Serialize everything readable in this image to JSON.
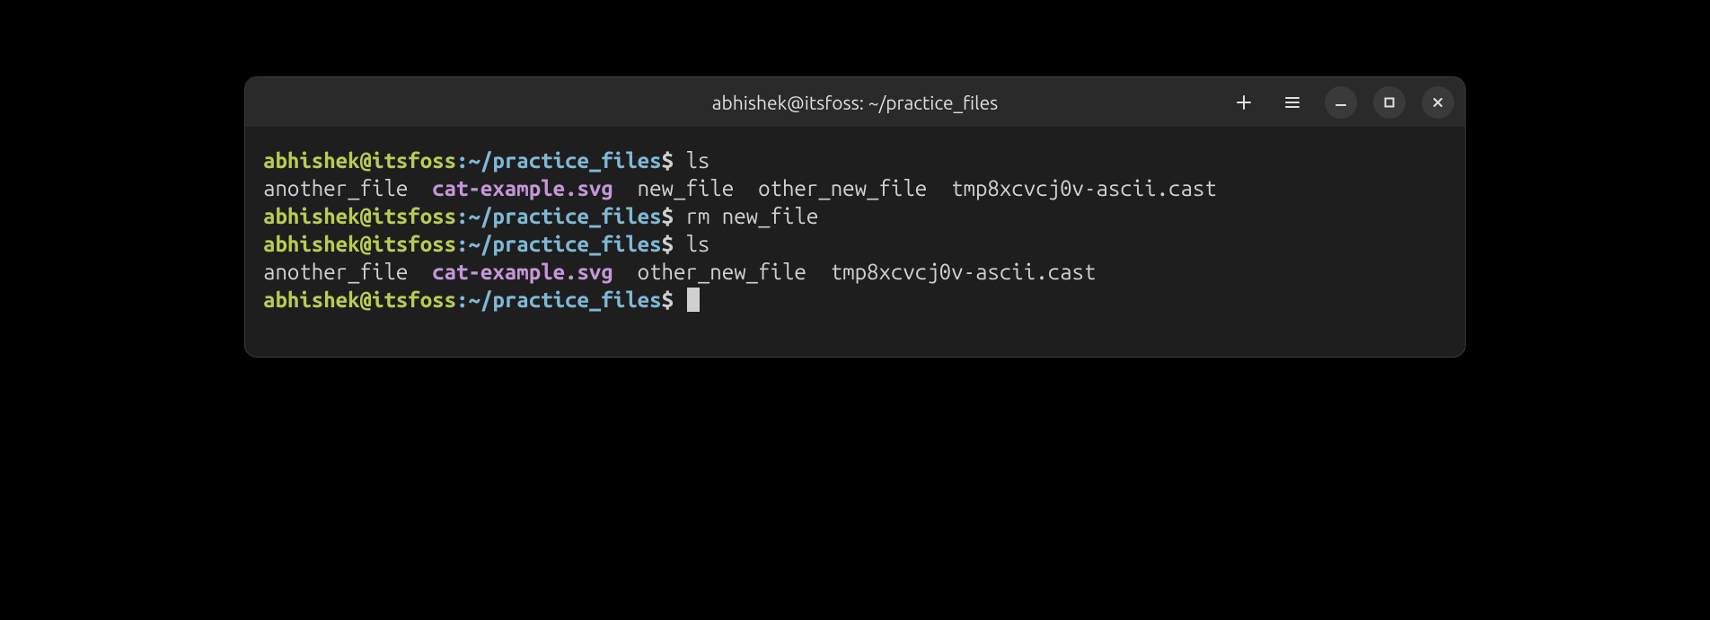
{
  "titlebar": {
    "title": "abhishek@itsfoss: ~/practice_files"
  },
  "prompt": {
    "userhost": "abhishek@itsfoss",
    "colon": ":",
    "path": "~/practice_files",
    "dollar": "$"
  },
  "lines": {
    "l1_cmd": "ls",
    "l2_file1": "another_file",
    "l2_gap1": "  ",
    "l2_svg": "cat-example.svg",
    "l2_gap2": "  ",
    "l2_rest": "new_file  other_new_file  tmp8xcvcj0v-ascii.cast",
    "l3_cmd": "rm new_file",
    "l4_cmd": "ls",
    "l5_file1": "another_file",
    "l5_gap1": "  ",
    "l5_svg": "cat-example.svg",
    "l5_gap2": "  ",
    "l5_rest": "other_new_file  tmp8xcvcj0v-ascii.cast"
  }
}
